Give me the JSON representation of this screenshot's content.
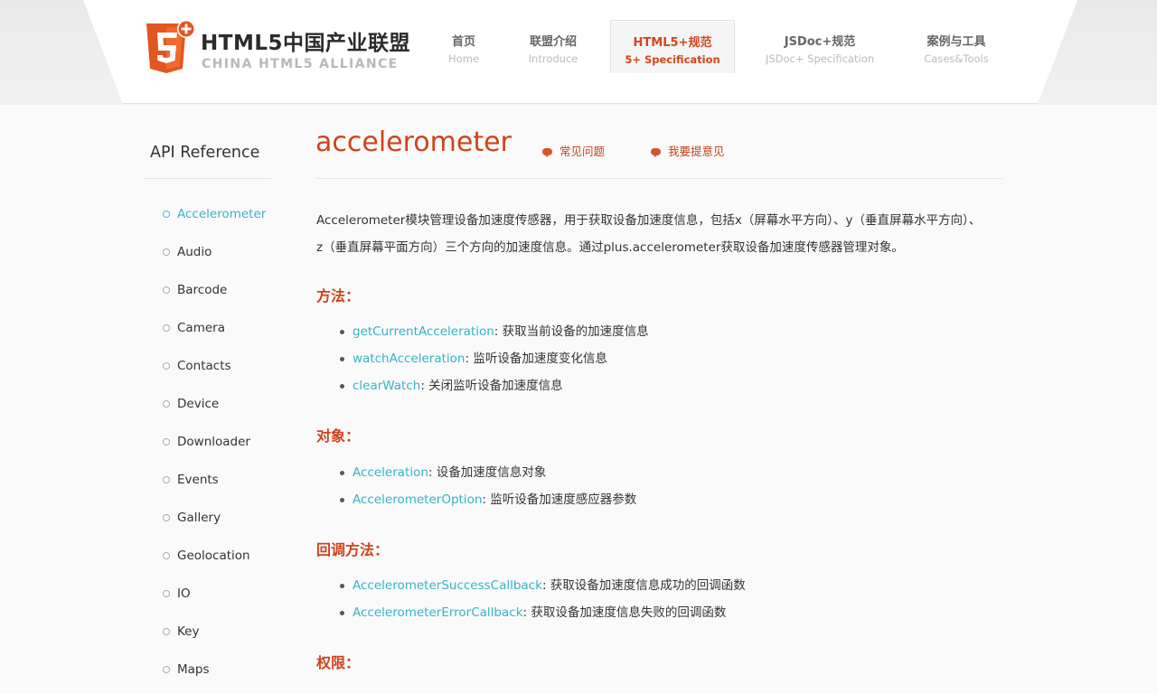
{
  "logo": {
    "title": "HTML5中国产业联盟",
    "subtitle": "CHINA HTML5 ALLIANCE",
    "badge": "5",
    "badge_plus": "+"
  },
  "nav": [
    {
      "zh": "首页",
      "en": "Home"
    },
    {
      "zh": "联盟介绍",
      "en": "Introduce"
    },
    {
      "zh": "HTML5+规范",
      "en": "5+ Specification"
    },
    {
      "zh": "JSDoc+规范",
      "en": "JSDoc+ Specification"
    },
    {
      "zh": "案例与工具",
      "en": "Cases&Tools"
    }
  ],
  "sidebar": {
    "title": "API Reference",
    "items": [
      "Accelerometer",
      "Audio",
      "Barcode",
      "Camera",
      "Contacts",
      "Device",
      "Downloader",
      "Events",
      "Gallery",
      "Geolocation",
      "IO",
      "Key",
      "Maps"
    ]
  },
  "main": {
    "title": "accelerometer",
    "faq_link": "常见问题",
    "feedback_link": "我要提意见",
    "description": "Accelerometer模块管理设备加速度传感器，用于获取设备加速度信息，包括x（屏幕水平方向）、y（垂直屏幕水平方向）、z（垂直屏幕平面方向）三个方向的加速度信息。通过plus.accelerometer获取设备加速度传感器管理对象。",
    "methods_heading": "方法：",
    "methods": [
      {
        "name": "getCurrentAcceleration",
        "desc": ": 获取当前设备的加速度信息"
      },
      {
        "name": "watchAcceleration",
        "desc": ": 监听设备加速度变化信息"
      },
      {
        "name": "clearWatch",
        "desc": ": 关闭监听设备加速度信息"
      }
    ],
    "objects_heading": "对象：",
    "objects": [
      {
        "name": "Acceleration",
        "desc": ": 设备加速度信息对象"
      },
      {
        "name": "AccelerometerOption",
        "desc": ": 监听设备加速度感应器参数"
      }
    ],
    "callbacks_heading": "回调方法：",
    "callbacks": [
      {
        "name": "AccelerometerSuccessCallback",
        "desc": ": 获取设备加速度信息成功的回调函数"
      },
      {
        "name": "AccelerometerErrorCallback",
        "desc": ": 获取设备加速度信息失败的回调函数"
      }
    ],
    "permissions_heading": "权限："
  },
  "colors": {
    "accent": "#d0431a",
    "link": "#35b3c7"
  }
}
